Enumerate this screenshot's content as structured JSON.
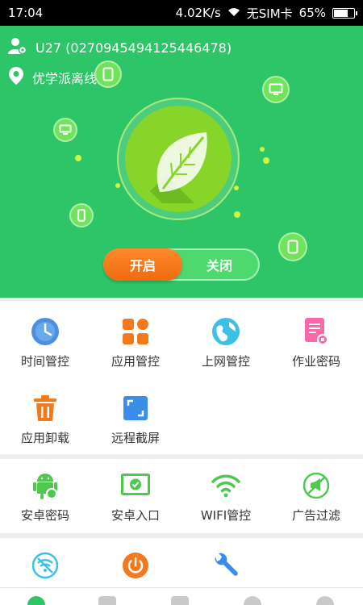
{
  "status_bar": {
    "time": "17:04",
    "speed": "4.02K/s",
    "sim": "无SIM卡",
    "battery": "65%",
    "battery_level": 0.65
  },
  "header": {
    "device": "U27 (0270945494125446478)",
    "status": "优学派离线"
  },
  "toggle": {
    "on_label": "开启",
    "off_label": "关闭",
    "state": "on"
  },
  "grid1": [
    {
      "label": "时间管控",
      "icon": "clock-icon"
    },
    {
      "label": "应用管控",
      "icon": "apps-icon"
    },
    {
      "label": "上网管控",
      "icon": "globe-icon"
    },
    {
      "label": "作业密码",
      "icon": "homework-lock-icon"
    },
    {
      "label": "应用卸载",
      "icon": "trash-icon"
    },
    {
      "label": "远程截屏",
      "icon": "screenshot-icon"
    }
  ],
  "grid2": [
    {
      "label": "安卓密码",
      "icon": "android-lock-icon"
    },
    {
      "label": "安卓入口",
      "icon": "android-entry-icon"
    },
    {
      "label": "WIFI管控",
      "icon": "wifi-icon"
    },
    {
      "label": "广告过滤",
      "icon": "ad-filter-icon"
    }
  ],
  "grid3": [
    {
      "label": "",
      "icon": "wifi-off-icon"
    },
    {
      "label": "",
      "icon": "power-icon"
    },
    {
      "label": "",
      "icon": "wrench-icon"
    }
  ],
  "colors": {
    "brand_green": "#2ec468",
    "orange": "#f37a1c",
    "blue": "#3b8de8"
  }
}
